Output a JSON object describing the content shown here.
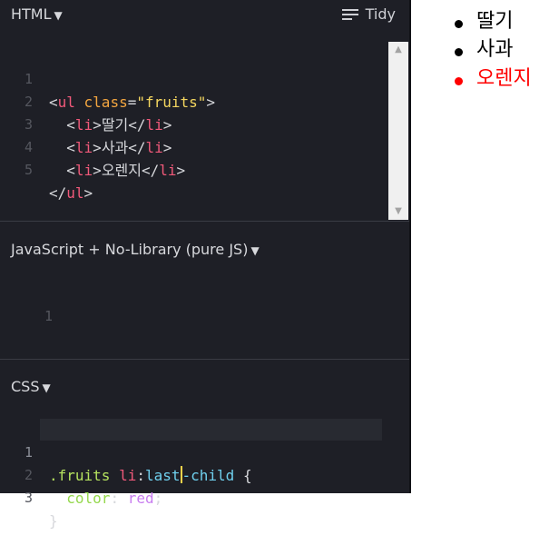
{
  "html_panel": {
    "title": "HTML",
    "caret": "▼",
    "tidy_label": "Tidy",
    "lines": [
      {
        "num": "1"
      },
      {
        "num": "2"
      },
      {
        "num": "3"
      },
      {
        "num": "4"
      },
      {
        "num": "5"
      }
    ],
    "code": {
      "l1": {
        "open": "<",
        "tag": "ul",
        "attr": " class",
        "eq": "=",
        "str": "\"fruits\"",
        "close": ">"
      },
      "l2": {
        "indent": "  ",
        "open": "<",
        "tag": "li",
        "close": ">",
        "text": "딸기",
        "open2": "</",
        "tag2": "li",
        "close2": ">"
      },
      "l3": {
        "indent": "  ",
        "open": "<",
        "tag": "li",
        "close": ">",
        "text": "사과",
        "open2": "</",
        "tag2": "li",
        "close2": ">"
      },
      "l4": {
        "indent": "  ",
        "open": "<",
        "tag": "li",
        "close": ">",
        "text": "오렌지",
        "open2": "</",
        "tag2": "li",
        "close2": ">"
      },
      "l5": {
        "open": "</",
        "tag": "ul",
        "close": ">"
      }
    }
  },
  "js_panel": {
    "title": "JavaScript + No-Library (pure JS)",
    "caret": "▼",
    "lines": [
      {
        "num": "1"
      }
    ]
  },
  "css_panel": {
    "title": "CSS",
    "caret": "▼",
    "lines": [
      {
        "num": "1"
      },
      {
        "num": "2"
      },
      {
        "num": "3"
      }
    ],
    "code": {
      "l1": {
        "cls": ".fruits",
        "sp": " ",
        "tag": "li",
        "colon": ":",
        "pseudo_a": "last",
        "pseudo_b": "-child",
        "brace": " {"
      },
      "l2": {
        "indent": "  ",
        "prop": "color",
        "colon": ": ",
        "val": "red",
        "semi": ";"
      },
      "l3": {
        "brace": "}"
      }
    }
  },
  "preview": {
    "items": [
      {
        "label": "딸기",
        "color": "#000000"
      },
      {
        "label": "사과",
        "color": "#000000"
      },
      {
        "label": "오렌지",
        "color": "#ff0000"
      }
    ]
  },
  "colors": {
    "editor_bg": "#1e1f26",
    "accent_red": "#ff0000",
    "tag": "#f1597a",
    "attr": "#f4a640",
    "string": "#f4d65f"
  },
  "icons": {
    "tidy": "align-left-icon",
    "caret": "triangle-down-icon",
    "scroll_up": "triangle-up-icon",
    "scroll_down": "triangle-down-icon"
  }
}
